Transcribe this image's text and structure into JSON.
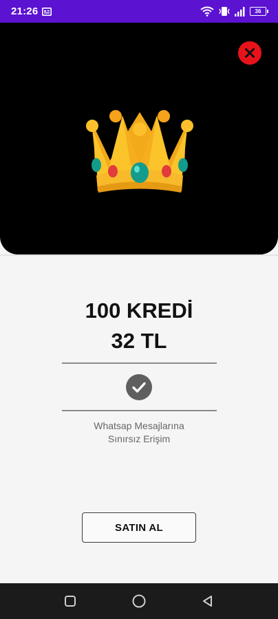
{
  "status_bar": {
    "time": "21:26",
    "battery": "36",
    "icons": [
      "calendar-icon",
      "wifi-icon",
      "vibrate-icon",
      "signal-icon",
      "battery-icon"
    ]
  },
  "hero": {
    "image": "crown-icon",
    "close_icon": "close-icon",
    "background": "#000000",
    "close_color": "#e8121b"
  },
  "product": {
    "credits": "100 KREDİ",
    "price": "32 TL",
    "feature_line1": "Whatsap Mesajlarına",
    "feature_line2": "Sınırsız Erişim",
    "check_icon": "check-circle-icon"
  },
  "buy_button": {
    "label": "SATIN AL"
  },
  "nav_bar": {
    "buttons": [
      "recents-square-icon",
      "home-circle-icon",
      "back-triangle-icon"
    ]
  },
  "colors": {
    "status_bar": "#5b12d1",
    "page_background": "#f5f5f5",
    "nav_bar": "#1b1b1b"
  }
}
